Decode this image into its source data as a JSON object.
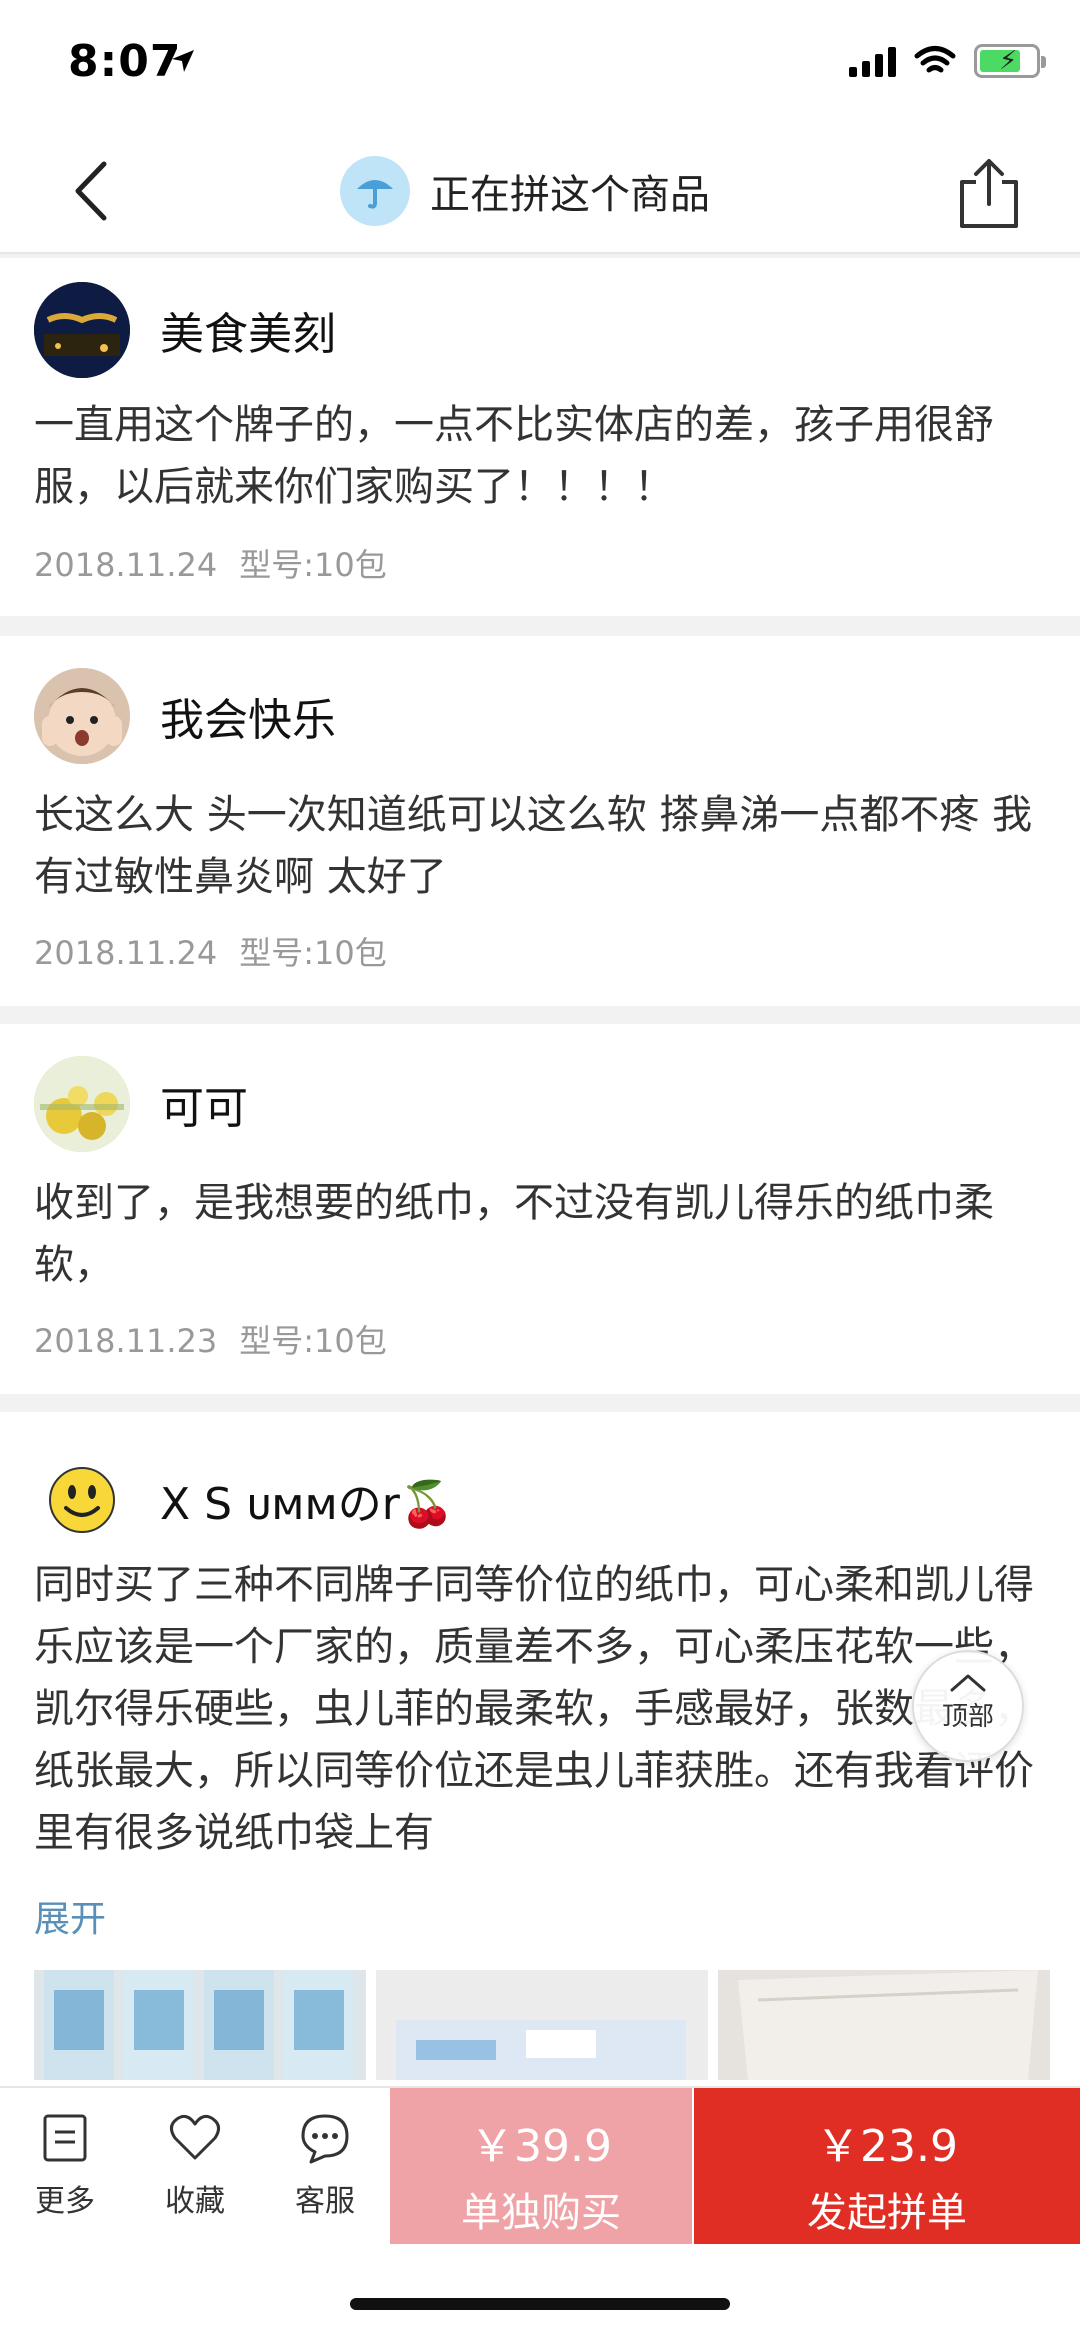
{
  "status_bar": {
    "time": "8:07"
  },
  "nav": {
    "title": "正在拼这个商品"
  },
  "reviews": [
    {
      "user": "美食美刻",
      "text": "一直用这个牌子的，一点不比实体店的差，孩子用很舒服，以后就来你们家购买了！！！！",
      "date": "2018.11.24",
      "spec": "型号:10包"
    },
    {
      "user": "我会快乐",
      "text": "长这么大 头一次知道纸可以这么软  搽鼻涕一点都不疼  我有过敏性鼻炎啊  太好了",
      "date": "2018.11.24",
      "spec": "型号:10包"
    },
    {
      "user": "可可",
      "text": "收到了，是我想要的纸巾，不过没有凯儿得乐的纸巾柔软，",
      "date": "2018.11.23",
      "spec": "型号:10包"
    },
    {
      "user": "X S ᴜᴍᴍのr🍒",
      "text": "同时买了三种不同牌子同等价位的纸巾，可心柔和凯儿得乐应该是一个厂家的，质量差不多，可心柔压花软一些，凯尔得乐硬些，虫儿菲的最柔软，手感最好，张数最多，纸张最大，所以同等价位还是虫儿菲获胜。还有我看评价里有很多说纸巾袋上有",
      "expand_label": "展开"
    }
  ],
  "float_button": {
    "label": "顶部"
  },
  "bottom_bar": {
    "more": "更多",
    "favorite": "收藏",
    "service": "客服",
    "single_price": "￥39.9",
    "single_label": "单独购买",
    "group_price": "￥23.9",
    "group_label": "发起拼单"
  },
  "colors": {
    "accent_red": "#e02e24",
    "light_red": "#f0a3a6",
    "link_blue": "#5a8fb8"
  }
}
